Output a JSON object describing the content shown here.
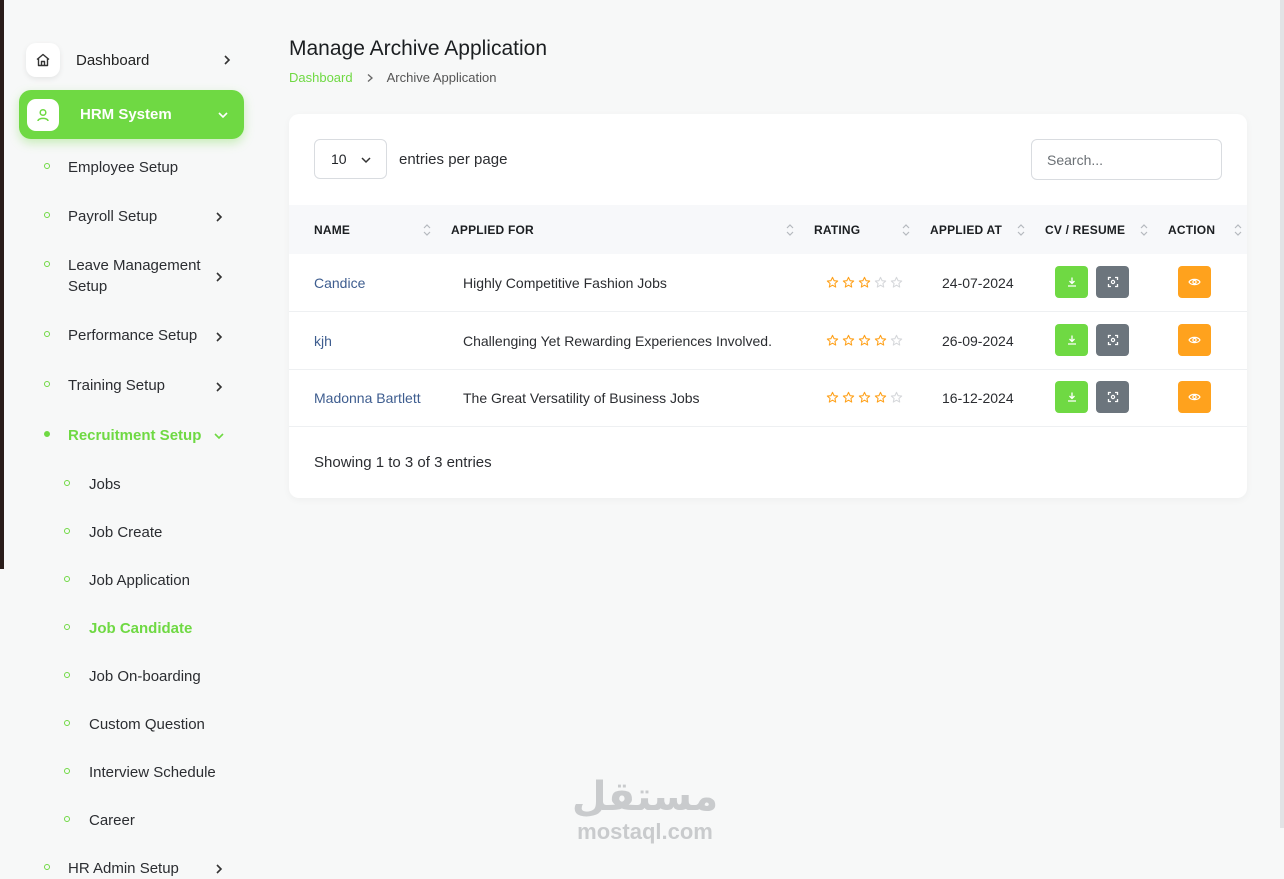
{
  "sidebar": {
    "dashboard_label": "Dashboard",
    "hrm_label": "HRM System",
    "items": [
      {
        "label": "Employee Setup"
      },
      {
        "label": "Payroll Setup"
      },
      {
        "label": "Leave Management Setup"
      },
      {
        "label": "Performance Setup"
      },
      {
        "label": "Training Setup"
      },
      {
        "label": "Recruitment Setup"
      },
      {
        "label": "HR Admin Setup"
      }
    ],
    "recruitment_items": [
      {
        "label": "Jobs"
      },
      {
        "label": "Job Create"
      },
      {
        "label": "Job Application"
      },
      {
        "label": "Job Candidate"
      },
      {
        "label": "Job On-boarding"
      },
      {
        "label": "Custom Question"
      },
      {
        "label": "Interview Schedule"
      },
      {
        "label": "Career"
      }
    ]
  },
  "header": {
    "title": "Manage Archive Application",
    "breadcrumb": {
      "home": "Dashboard",
      "current": "Archive Application"
    }
  },
  "table_controls": {
    "entries_value": "10",
    "entries_label": "entries per page",
    "search_placeholder": "Search..."
  },
  "table": {
    "columns": [
      "NAME",
      "APPLIED FOR",
      "RATING",
      "APPLIED AT",
      "CV / RESUME",
      "ACTION"
    ],
    "rows": [
      {
        "name": "Candice",
        "applied_for": "Highly Competitive Fashion Jobs",
        "rating": 3,
        "applied_at": "24-07-2024"
      },
      {
        "name": "kjh",
        "applied_for": "Challenging Yet Rewarding Experiences Involved.",
        "rating": 4,
        "applied_at": "26-09-2024"
      },
      {
        "name": "Madonna Bartlett",
        "applied_for": "The Great Versatility of Business Jobs",
        "rating": 4,
        "applied_at": "16-12-2024"
      }
    ],
    "footer": "Showing 1 to 3 of 3 entries"
  },
  "watermark": {
    "arabic": "مستقل",
    "latin": "mostaql.com"
  },
  "colors": {
    "accent": "#6fd943",
    "star": "#ffa21d",
    "link": "#3e5d8f",
    "gray_button": "#6c757d",
    "action_button": "#ffa21d"
  }
}
